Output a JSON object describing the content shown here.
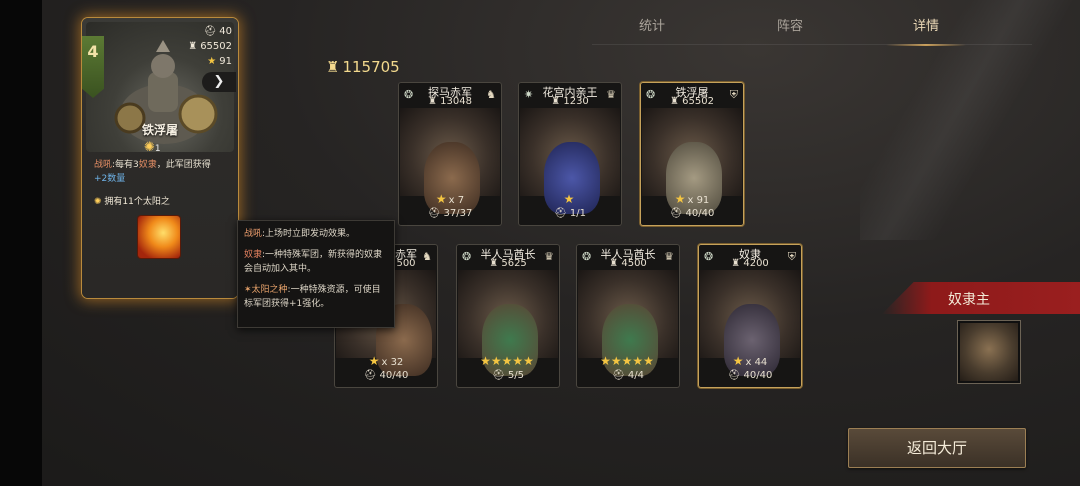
{
  "tabs": [
    {
      "label": "统计",
      "active": false
    },
    {
      "label": "阵容",
      "active": false
    },
    {
      "label": "详情",
      "active": true
    }
  ],
  "featured": {
    "level": "4",
    "stat_command": "40",
    "stat_power": "65502",
    "stat_stars": "91",
    "name": "铁浮屠",
    "sun_count": "1",
    "desc_prefix": "战吼",
    "desc_part1": ":每有3",
    "desc_kw": "奴隶",
    "desc_part2": "，此军团获得",
    "desc_bonus": "+2数量",
    "own_text": "拥有11个太阳之"
  },
  "total_power": "115705",
  "units": [
    {
      "title": "探马赤军",
      "power": "13048",
      "stars": "★",
      "star_count": "x 7",
      "troops": "37/37"
    },
    {
      "title": "花宫内亲王",
      "power": "1230",
      "stars": "★",
      "star_count": "",
      "troops": "1/1"
    },
    {
      "title": "铁浮屠",
      "power": "65502",
      "stars": "★",
      "star_count": "x 91",
      "troops": "40/40"
    },
    {
      "title": "赤军",
      "power": "500",
      "stars": "★",
      "star_count": "x 32",
      "troops": "40/40"
    },
    {
      "title": "半人马酋长",
      "power": "5625",
      "stars": "★★★★★",
      "star_count": "",
      "troops": "5/5"
    },
    {
      "title": "半人马酋长",
      "power": "4500",
      "stars": "★★★★★",
      "star_count": "",
      "troops": "4/4"
    },
    {
      "title": "奴隶",
      "power": "4200",
      "stars": "★",
      "star_count": "x 44",
      "troops": "40/40"
    }
  ],
  "tooltip": {
    "line1_kw": "战吼",
    "line1_text": ":上场时立即发动效果。",
    "line2_kw": "奴隶",
    "line2_text": ":一种特殊军团，新获得的奴隶会自动加入其中。",
    "line3_kw": "✶太阳之种",
    "line3_text": ":一种特殊资源，可使目标军团获得+1强化。"
  },
  "owner": {
    "label": "奴隶主"
  },
  "back_button": "返回大厅",
  "colors": {
    "accent_gold": "#c6a25b",
    "ribbon_red": "#9a1f1f",
    "star": "#f4c542"
  }
}
